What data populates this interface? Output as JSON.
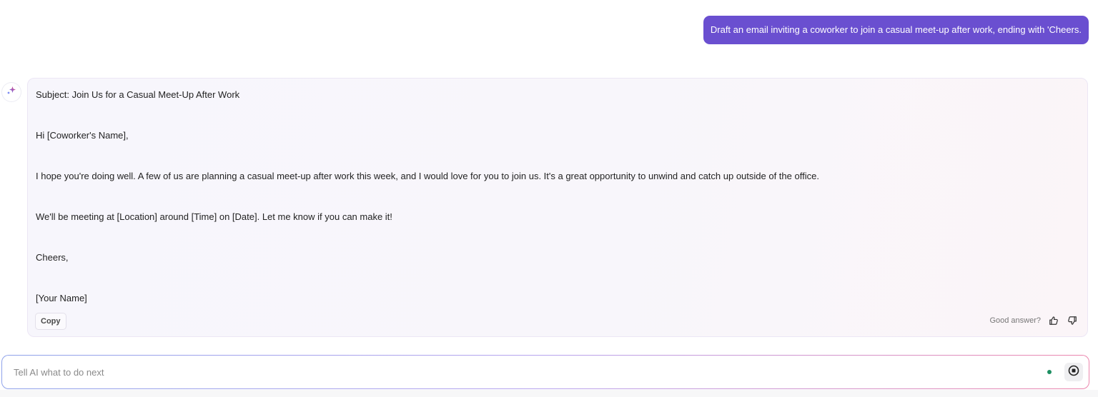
{
  "user_message": {
    "text": "Draft an email inviting a coworker to join a casual meet-up after work, ending with 'Cheers."
  },
  "ai_response": {
    "avatar_icon": "sparkle-icon",
    "lines": [
      "Subject: Join Us for a Casual Meet-Up After Work",
      "Hi [Coworker's Name],",
      "I hope you're doing well. A few of us are planning a casual meet-up after work this week, and I would love for you to join us. It's a great opportunity to unwind and catch up outside of the office.",
      "We'll be meeting at [Location] around [Time] on [Date]. Let me know if you can make it!",
      "Cheers,",
      "[Your Name]"
    ],
    "copy_label": "Copy",
    "feedback_label": "Good answer?",
    "thumbs_up_icon": "thumbs-up-icon",
    "thumbs_down_icon": "thumbs-down-icon"
  },
  "input_bar": {
    "placeholder": "Tell AI what to do next",
    "value": "",
    "status_color": "#1e8f62",
    "stop_icon": "stop-icon"
  },
  "colors": {
    "user_bubble": "#6a4fd0",
    "card_background": "#f7f6fc",
    "input_border_start": "#8fa2ea",
    "input_border_end": "#ec86ad"
  }
}
